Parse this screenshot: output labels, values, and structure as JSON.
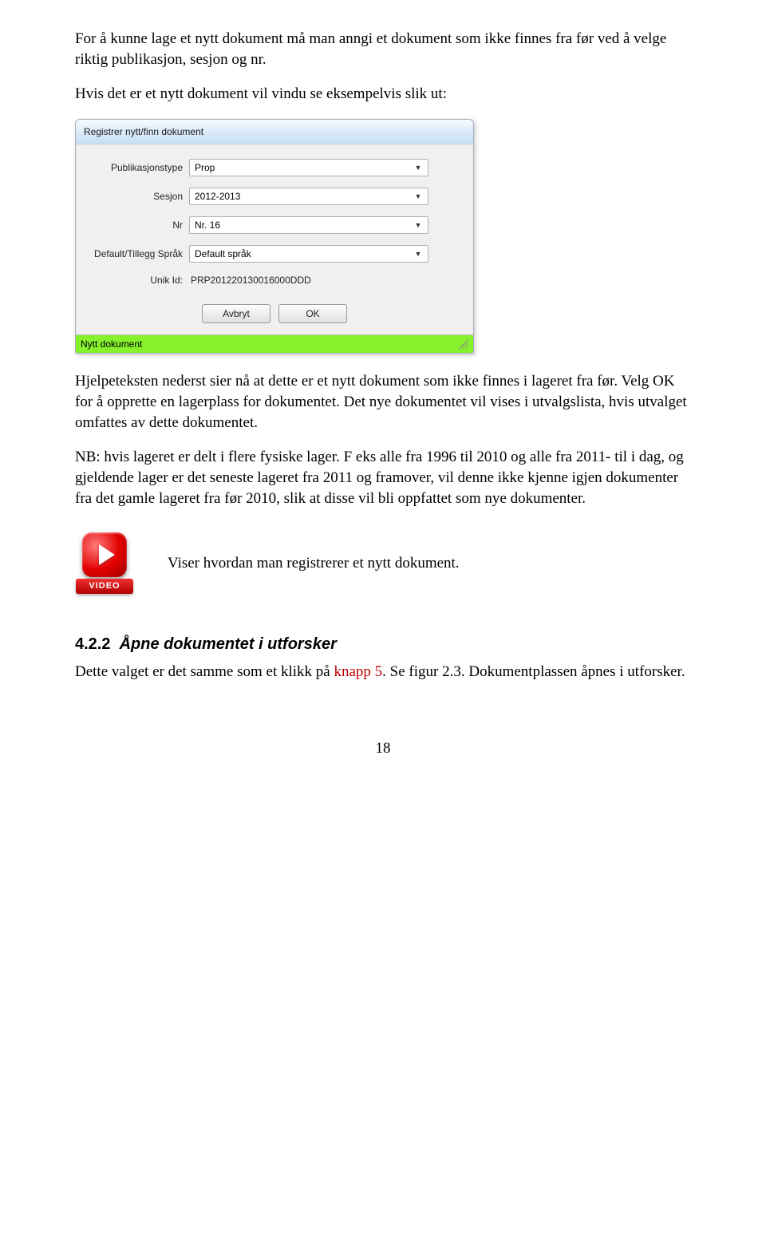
{
  "para1": "For å kunne lage et nytt dokument må man anngi et dokument som ikke finnes fra før ved å velge riktig publikasjon, sesjon og nr.",
  "para2": "Hvis det er et nytt dokument vil vindu se eksempelvis slik ut:",
  "dialog": {
    "title": "Registrer nytt/finn dokument",
    "fields": {
      "pubtype_label": "Publikasjonstype",
      "pubtype_value": "Prop",
      "sesjon_label": "Sesjon",
      "sesjon_value": "2012-2013",
      "nr_label": "Nr",
      "nr_value": "Nr. 16",
      "lang_label": "Default/Tillegg Språk",
      "lang_value": "Default språk",
      "unikid_label": "Unik Id:",
      "unikid_value": "PRP201220130016000DDD"
    },
    "buttons": {
      "cancel": "Avbryt",
      "ok": "OK"
    },
    "status": "Nytt dokument"
  },
  "para3": "Hjelpeteksten nederst sier nå at dette er et nytt dokument som ikke finnes i lageret fra før. Velg OK for å opprette en lagerplass for dokumentet. Det nye dokumentet vil vises i utvalgslista, hvis utvalget omfattes av dette dokumentet.",
  "para4": "NB: hvis lageret er delt i flere fysiske lager. F eks alle fra 1996 til 2010  og alle fra 2011- til i dag,  og gjeldende lager er det seneste lageret fra 2011 og framover, vil denne ikke kjenne igjen dokumenter fra det gamle lageret fra før 2010, slik at disse vil bli oppfattet som nye dokumenter.",
  "video": {
    "label": "VIDEO",
    "caption": "Viser hvordan man registrerer et nytt dokument."
  },
  "subhead": {
    "num": "4.2.2",
    "title": "Åpne dokumentet i utforsker"
  },
  "para5a": "Dette valget er det samme som et klikk på ",
  "para5_link": "knapp 5",
  "para5b": ". Se figur 2.3. Dokumentplassen åpnes i utforsker.",
  "page_number": "18"
}
